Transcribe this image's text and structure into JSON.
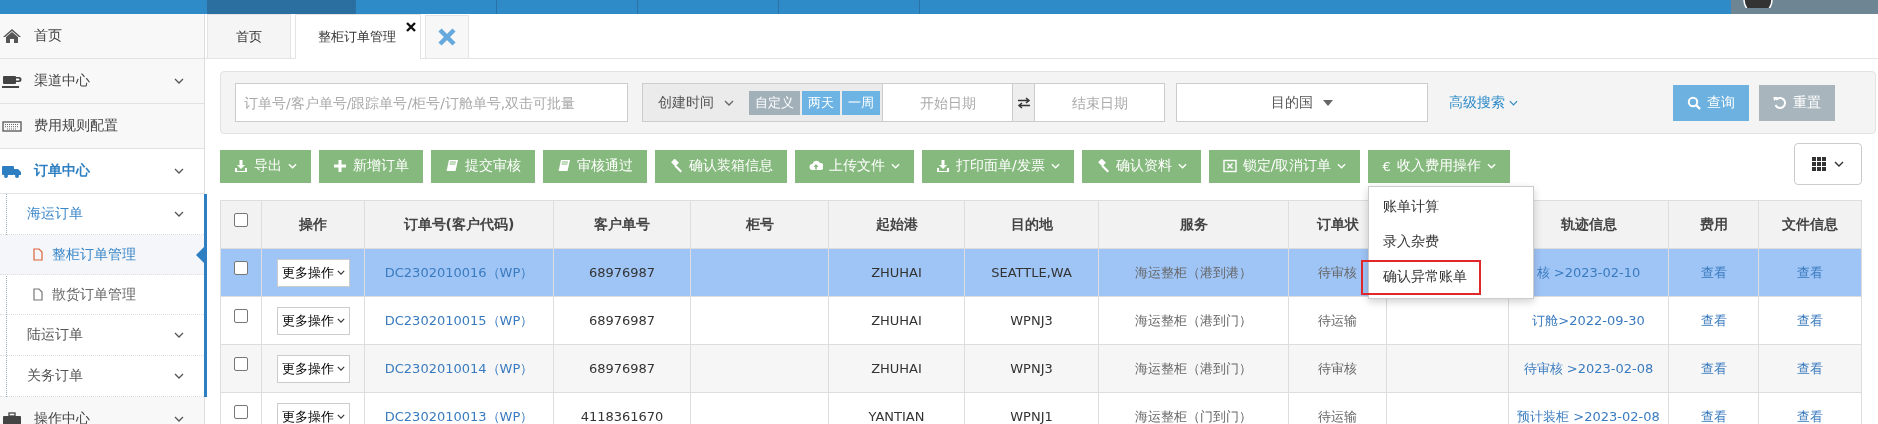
{
  "sidebar": {
    "items": [
      {
        "label": "首页",
        "kind": "link",
        "selected": false
      },
      {
        "label": "渠道中心",
        "kind": "group",
        "selected": false
      },
      {
        "label": "费用规则配置",
        "kind": "link",
        "selected": false
      },
      {
        "label": "订单中心",
        "kind": "group",
        "selected": true,
        "children": [
          {
            "label": "海运订单",
            "kind": "group",
            "selected": true,
            "children": [
              {
                "label": "整柜订单管理",
                "kind": "link",
                "selected": true
              },
              {
                "label": "散货订单管理",
                "kind": "link",
                "selected": false
              }
            ]
          },
          {
            "label": "陆运订单",
            "kind": "group",
            "selected": false
          },
          {
            "label": "关务订单",
            "kind": "group",
            "selected": false
          }
        ]
      },
      {
        "label": "操作中心",
        "kind": "group",
        "selected": false
      }
    ]
  },
  "tabs": [
    {
      "label": "首页",
      "selected": false,
      "closable": false
    },
    {
      "label": "整柜订单管理",
      "selected": true,
      "closable": true
    }
  ],
  "search": {
    "keyword_placeholder": "订单号/客户单号/跟踪单号/柜号/订舱单号,双击可批量",
    "date_type": "创建时间",
    "ranges": [
      {
        "label": "自定义",
        "selected": true
      },
      {
        "label": "两天",
        "selected": false
      },
      {
        "label": "一周",
        "selected": false
      }
    ],
    "start_placeholder": "开始日期",
    "end_placeholder": "结束日期",
    "country": "目的国",
    "advanced": "高级搜索",
    "query": "查询",
    "reset": "重置"
  },
  "toolbar": [
    {
      "label": "导出",
      "dropdown": true
    },
    {
      "label": "新增订单",
      "dropdown": false
    },
    {
      "label": "提交审核",
      "dropdown": false
    },
    {
      "label": "审核通过",
      "dropdown": false
    },
    {
      "label": "确认装箱信息",
      "dropdown": false
    },
    {
      "label": "上传文件",
      "dropdown": true
    },
    {
      "label": "打印面单/发票",
      "dropdown": true
    },
    {
      "label": "确认资料",
      "dropdown": true
    },
    {
      "label": "锁定/取消订单",
      "dropdown": true
    },
    {
      "label": "收入费用操作",
      "dropdown": true,
      "symbol": "€"
    }
  ],
  "menu": [
    {
      "label": "账单计算",
      "selected": false
    },
    {
      "label": "录入杂费",
      "selected": false
    },
    {
      "label": "确认异常账单",
      "selected": true
    }
  ],
  "table": {
    "all_checked": false,
    "columns": [
      "操作",
      "订单号(客户代码)",
      "客户单号",
      "柜号",
      "起始港",
      "目的地",
      "服务",
      "订单状",
      "轨迹信息",
      "费用",
      "文件信息"
    ],
    "rows": [
      {
        "checked": false,
        "selected": true,
        "action": "更多操作",
        "order_no": "DC2302010016（WP）",
        "customer_no": "68976987",
        "origin": "ZHUHAI",
        "destination": "SEATTLE,WA",
        "service": "海运整柜（港到港）",
        "status": "待审核",
        "track": "核 >2023-02-10",
        "fee": "查看",
        "file": "查看"
      },
      {
        "checked": false,
        "selected": false,
        "action": "更多操作",
        "order_no": "DC2302010015（WP）",
        "customer_no": "68976987",
        "origin": "ZHUHAI",
        "destination": "WPNJ3",
        "service": "海运整柜（港到门）",
        "status": "待运输",
        "track": "订舱>2022-09-30",
        "fee": "查看",
        "file": "查看"
      },
      {
        "checked": false,
        "selected": false,
        "action": "更多操作",
        "order_no": "DC2302010014（WP）",
        "customer_no": "68976987",
        "origin": "ZHUHAI",
        "destination": "WPNJ3",
        "service": "海运整柜（港到门）",
        "status": "待审核",
        "track": "待审核 >2023-02-08",
        "fee": "查看",
        "file": "查看"
      },
      {
        "checked": false,
        "selected": false,
        "action": "更多操作",
        "order_no": "DC2302010013（WP）",
        "customer_no": "4118361670",
        "origin": "YANTIAN",
        "destination": "WPNJ1",
        "service": "海运整柜（门到门）",
        "status": "待运输",
        "track": "预计装柜 >2023-02-08",
        "fee": "查看",
        "file": "查看"
      }
    ]
  }
}
